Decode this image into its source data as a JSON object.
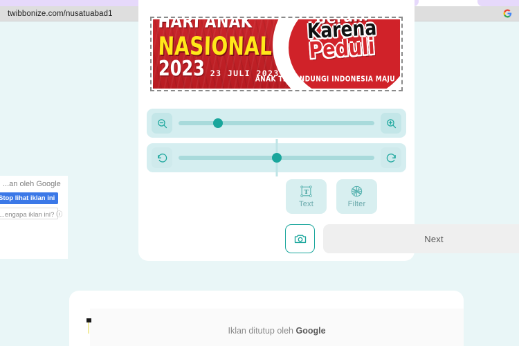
{
  "browser": {
    "url": "twibbonize.com/nusatuabad1",
    "google_icon": "google-g-icon"
  },
  "banner": {
    "line1": "HARI ANAK",
    "line2": "NASIONAL",
    "year": "2023",
    "date": "23 JULI 2023",
    "badge_line1": "Berani",
    "badge_line2": "Karena",
    "badge_line3": "Peduli",
    "tagline": "ANAK TERLINDUNGI INDONESIA MAJU",
    "colors": {
      "background": "#c62026",
      "highlight": "#ffe81a",
      "peduli": "#d5262c"
    }
  },
  "controls": {
    "zoom": {
      "decrease_icon": "zoom-out-icon",
      "increase_icon": "zoom-in-icon",
      "value_percent": 20
    },
    "rotate": {
      "left_icon": "rotate-left-icon",
      "right_icon": "rotate-right-icon",
      "value_percent": 50
    }
  },
  "tools": [
    {
      "label": "Text",
      "icon": "text-box-icon"
    },
    {
      "label": "Filter",
      "icon": "aperture-icon"
    }
  ],
  "actions": {
    "camera_icon": "camera-icon",
    "next_label": "Next"
  },
  "ad_popup": {
    "header": "...an oleh Google",
    "stop_label": "Stop lihat iklan ini",
    "why_label": "...engapa iklan ini? ⓘ"
  },
  "bottom_ad": {
    "text": "Iklan ditutup oleh ",
    "brand": "Google"
  },
  "theme": {
    "page_background": "#e9f6f7",
    "accent": "#1aa69c",
    "slider_track": "#a8dadb",
    "panel": "#d5eef0"
  }
}
